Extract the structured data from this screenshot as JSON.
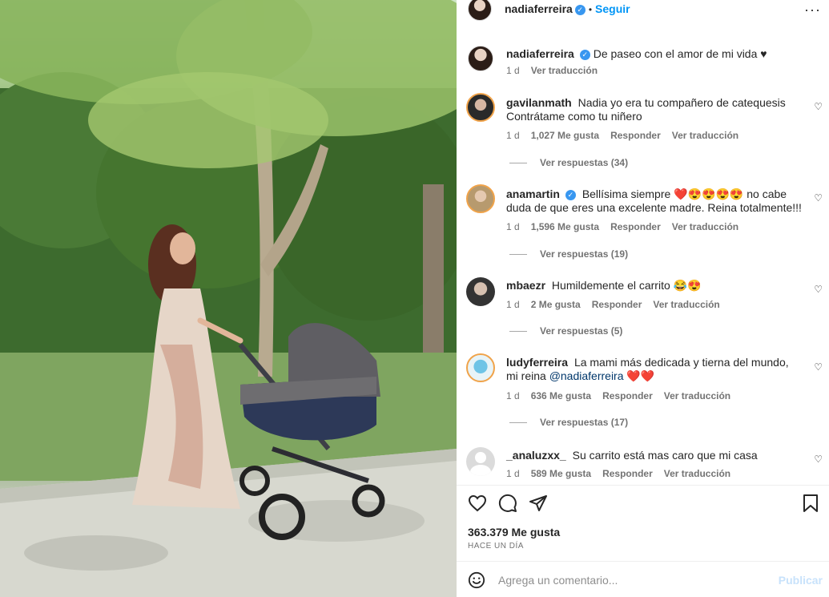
{
  "photo": {
    "alt": ""
  },
  "post": {
    "author": "nadiaferreira",
    "follow_label": "Seguir",
    "separator": "•",
    "more_label": "···",
    "caption": "De paseo con el amor de mi vida ♥",
    "caption_age": "1 d",
    "caption_translate": "Ver traducción"
  },
  "comments": [
    {
      "user": "gavilanmath",
      "verified": false,
      "text": "Nadia yo era tu compañero de catequesis Contrátame como tu niñero",
      "age": "1 d",
      "likes": "1,027 Me gusta",
      "reply": "Responder",
      "translate": "Ver traducción",
      "replies": "Ver respuestas (34)"
    },
    {
      "user": "anamartin",
      "verified": true,
      "text": "Bellísima siempre ❤️😍😍😍😍 no cabe duda de que eres una excelente madre. Reina totalmente!!!",
      "age": "1 d",
      "likes": "1,596 Me gusta",
      "reply": "Responder",
      "translate": "Ver traducción",
      "replies": "Ver respuestas (19)"
    },
    {
      "user": "mbaezr",
      "verified": false,
      "text": "Humildemente el carrito 😂😍",
      "age": "1 d",
      "likes": "2 Me gusta",
      "reply": "Responder",
      "translate": "Ver traducción",
      "replies": "Ver respuestas (5)"
    },
    {
      "user": "ludyferreira",
      "verified": false,
      "text_before": "La mami más dedicada y tierna del mundo, mi reina",
      "mention": "@nadiaferreira",
      "text_after": "❤️❤️",
      "age": "1 d",
      "likes": "636 Me gusta",
      "reply": "Responder",
      "translate": "Ver traducción",
      "replies": "Ver respuestas (17)"
    },
    {
      "user": "_analuzxx_",
      "verified": false,
      "text": "Su carrito está mas caro que mi casa",
      "age": "1 d",
      "likes": "589 Me gusta",
      "reply": "Responder",
      "translate": "Ver traducción"
    }
  ],
  "actions": {
    "likes": "363.379 Me gusta",
    "ago": "HACE UN DÍA"
  },
  "add_comment": {
    "placeholder": "Agrega un comentario...",
    "post_label": "Publicar"
  },
  "icons": [
    "heart-icon",
    "comment-icon",
    "share-icon",
    "bookmark-icon",
    "emoji-icon",
    "verified-icon",
    "more-icon"
  ],
  "colors": {
    "link": "#0095f6",
    "verified": "#3897f0",
    "muted": "#737373",
    "mention": "#00376b",
    "post_disabled": "#c8e2fb"
  }
}
